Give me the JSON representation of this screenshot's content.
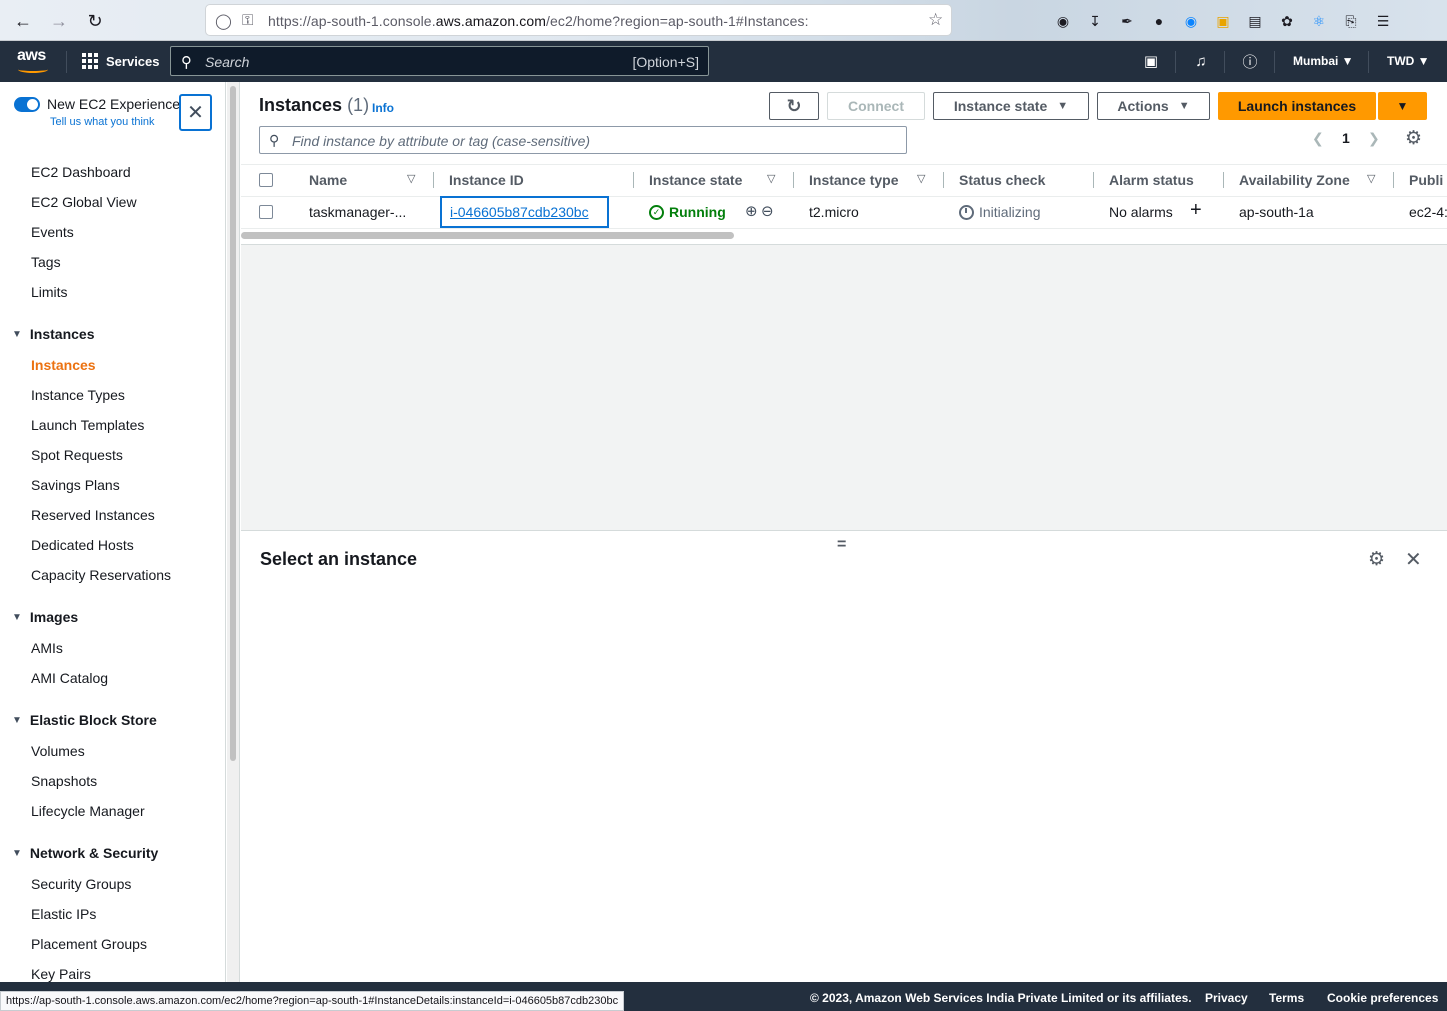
{
  "browser": {
    "url_prefix": "https://ap-south-1.console.",
    "url_domain": "aws.amazon.com",
    "url_suffix": "/ec2/home?region=ap-south-1#Instances:",
    "status_url": "https://ap-south-1.console.aws.amazon.com/ec2/home?region=ap-south-1#InstanceDetails:instanceId=i-046605b87cdb230bc"
  },
  "topnav": {
    "logo": "aws",
    "services_label": "Services",
    "search_placeholder": "Search",
    "search_shortcut": "[Option+S]",
    "region": "Mumbai",
    "account": "TWD"
  },
  "sidebar": {
    "toggle_label": "New EC2 Experience",
    "toggle_sub": "Tell us what you think",
    "top_links": [
      "EC2 Dashboard",
      "EC2 Global View",
      "Events",
      "Tags",
      "Limits"
    ],
    "sections": [
      {
        "title": "Instances",
        "items": [
          "Instances",
          "Instance Types",
          "Launch Templates",
          "Spot Requests",
          "Savings Plans",
          "Reserved Instances",
          "Dedicated Hosts",
          "Capacity Reservations"
        ]
      },
      {
        "title": "Images",
        "items": [
          "AMIs",
          "AMI Catalog"
        ]
      },
      {
        "title": "Elastic Block Store",
        "items": [
          "Volumes",
          "Snapshots",
          "Lifecycle Manager"
        ]
      },
      {
        "title": "Network & Security",
        "items": [
          "Security Groups",
          "Elastic IPs",
          "Placement Groups",
          "Key Pairs"
        ]
      }
    ],
    "active_item": "Instances"
  },
  "header": {
    "title": "Instances",
    "count": "(1)",
    "info": "Info",
    "connect_label": "Connect",
    "instance_state_label": "Instance state",
    "actions_label": "Actions",
    "launch_label": "Launch instances",
    "find_placeholder": "Find instance by attribute or tag (case-sensitive)",
    "page": "1"
  },
  "table": {
    "columns": [
      "Name",
      "Instance ID",
      "Instance state",
      "Instance type",
      "Status check",
      "Alarm status",
      "Availability Zone",
      "Publi"
    ],
    "row": {
      "name": "taskmanager-...",
      "instance_id": "i-046605b87cdb230bc",
      "state": "Running",
      "type": "t2.micro",
      "status_check": "Initializing",
      "alarm": "No alarms",
      "az": "ap-south-1a",
      "public": "ec2-4:"
    }
  },
  "detail": {
    "title": "Select an instance"
  },
  "footer": {
    "copyright": "© 2023, Amazon Web Services India Private Limited or its affiliates.",
    "privacy": "Privacy",
    "terms": "Terms",
    "cookies": "Cookie preferences"
  }
}
